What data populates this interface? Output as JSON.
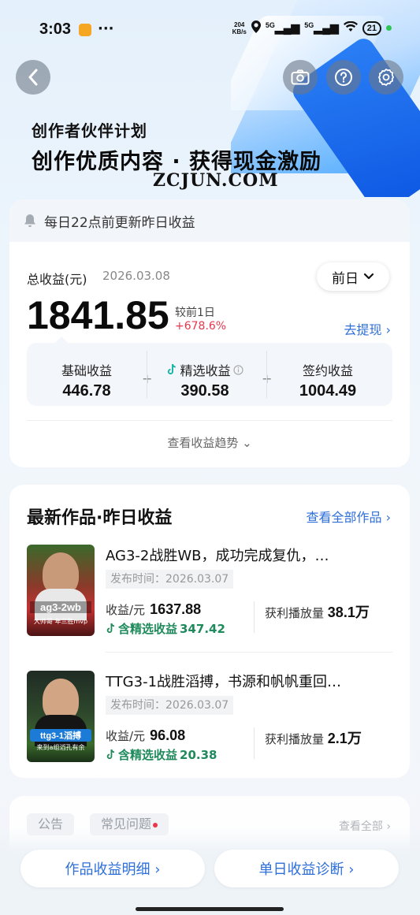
{
  "status_bar": {
    "time": "3:03",
    "dots": "···",
    "net_speed_top": "204",
    "net_speed_unit": "KB/s",
    "signal1": "5G",
    "signal2": "5G",
    "battery": "21"
  },
  "hero": {
    "subtitle": "创作者伙伴计划",
    "title": "创作优质内容 · 获得现金激励",
    "watermark": "ZCJUN.COM"
  },
  "notice": {
    "text": "每日22点前更新昨日收益"
  },
  "summary": {
    "label": "总收益(元)",
    "date": "2026.03.08",
    "selector": "前日",
    "total": "1841.85",
    "compare_label": "较前1日",
    "compare_value": "+678.6%",
    "withdraw": "去提现 ›"
  },
  "breakdown": [
    {
      "label": "基础收益",
      "value": "446.78"
    },
    {
      "label": "精选收益",
      "value": "390.58"
    },
    {
      "label": "签约收益",
      "value": "1004.49"
    }
  ],
  "trend": "查看收益趋势 ⌄",
  "works": {
    "title": "最新作品·昨日收益",
    "view_all": "查看全部作品 ›",
    "items": [
      {
        "title": "AG3-2战胜WB，成功完成复仇，…",
        "date": "发布时间：2026.03.07",
        "earn_label": "收益/元",
        "earn_value": "1637.88",
        "select_label": "含精选收益",
        "select_value": "347.42",
        "plays_label": "获利播放量",
        "plays_value": "38.1万",
        "thumb_caption": "ag3-2wb",
        "thumb_sub": "大帅哥 年三胜mvp"
      },
      {
        "title": "TTG3-1战胜滔搏，书源和帆帆重回…",
        "date": "发布时间：2026.03.07",
        "earn_label": "收益/元",
        "earn_value": "96.08",
        "select_label": "含精选收益",
        "select_value": "20.38",
        "plays_label": "获利播放量",
        "plays_value": "2.1万",
        "thumb_caption": "ttg3-1滔搏",
        "thumb_sub": "来到a组滔孔有余"
      }
    ]
  },
  "faq": {
    "tab1": "公告",
    "tab2": "常见问题",
    "more": "查看全部 ›"
  },
  "bottom": {
    "btn1": "作品收益明细 ›",
    "btn2": "单日收益诊断 ›"
  },
  "colors": {
    "accent": "#2e6fd8",
    "positive": "#e8364c",
    "select_green": "#1f8a5b"
  }
}
